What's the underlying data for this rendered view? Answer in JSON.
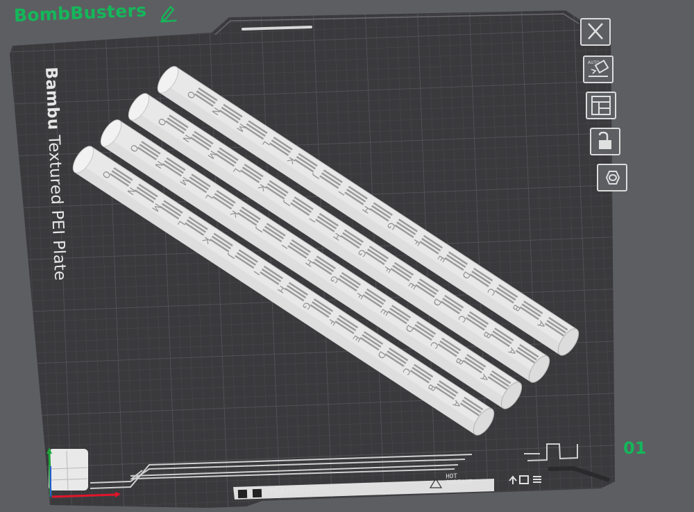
{
  "app": {
    "project_name": "BombBusters",
    "plate_label_brand": "Bambu",
    "plate_label_rest": " Textured PEI Plate",
    "plate_number": "01"
  },
  "plate_marks": {
    "material_text": "PLA/ABS/PETG",
    "hot_surface_line1": "HOT",
    "hot_surface_line2": "SURFACE"
  },
  "toolbar": {
    "items": [
      {
        "name": "close-button",
        "icon": "close-icon"
      },
      {
        "name": "auto-orient-button",
        "icon": "auto-orient-icon",
        "badge": "AUTO"
      },
      {
        "name": "arrange-button",
        "icon": "arrange-icon"
      },
      {
        "name": "lock-button",
        "icon": "unlock-icon"
      },
      {
        "name": "settings-button",
        "icon": "hex-nut-icon"
      }
    ]
  },
  "parts": {
    "count": 4,
    "letters": [
      "A",
      "B",
      "C",
      "D",
      "E",
      "F",
      "G",
      "H",
      "I",
      "J",
      "K",
      "L",
      "M",
      "N",
      "O"
    ]
  },
  "colors": {
    "background": "#5d5e62",
    "plate": "#3d3d40",
    "accent": "#14b75a",
    "part": "#e9e9e9"
  }
}
